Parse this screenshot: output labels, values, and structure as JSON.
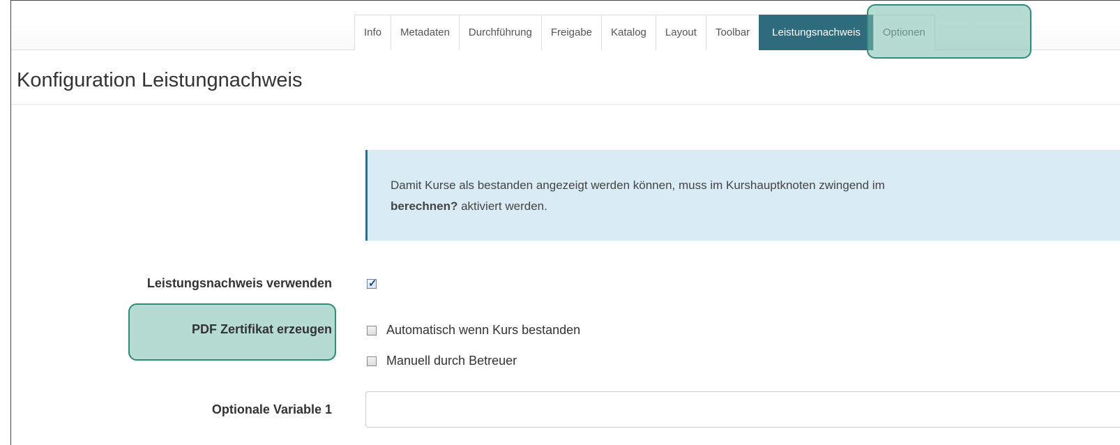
{
  "tabs": [
    {
      "label": "Info",
      "active": false
    },
    {
      "label": "Metadaten",
      "active": false
    },
    {
      "label": "Durchführung",
      "active": false
    },
    {
      "label": "Freigabe",
      "active": false
    },
    {
      "label": "Katalog",
      "active": false
    },
    {
      "label": "Layout",
      "active": false
    },
    {
      "label": "Toolbar",
      "active": false
    },
    {
      "label": "Leistungsnachweis",
      "active": true
    },
    {
      "label": "Optionen",
      "active": false
    }
  ],
  "page": {
    "title": "Konfiguration Leistungnachweis"
  },
  "info": {
    "text_line1": "Damit Kurse als bestanden angezeigt werden können, muss im Kurshauptknoten zwingend im",
    "bold_part": "berechnen?",
    "text_line2_rest": " aktiviert werden."
  },
  "form": {
    "use_label": "Leistungsnachweis verwenden",
    "use_checked": true,
    "pdf_label": "PDF Zertifikat erzeugen",
    "pdf_options": [
      {
        "label": "Automatisch wenn Kurs bestanden",
        "checked": false
      },
      {
        "label": "Manuell durch Betreuer",
        "checked": false
      }
    ],
    "var1_label": "Optionale Variable 1",
    "var1_value": ""
  },
  "colors": {
    "active_tab": "#2e6b7c",
    "highlight": "#78beaf",
    "info_bg": "#d9ecf6"
  }
}
